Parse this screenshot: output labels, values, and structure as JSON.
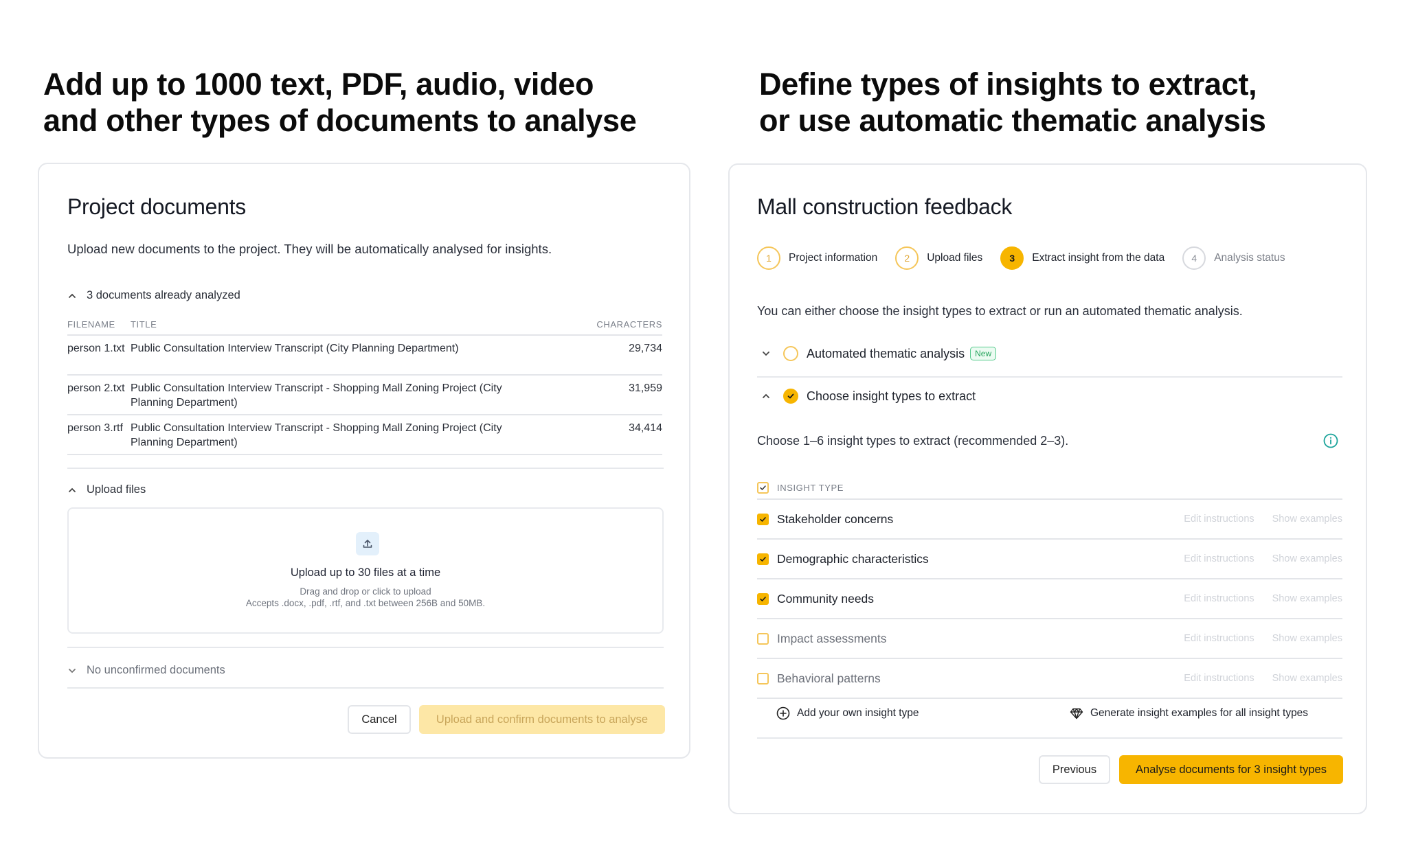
{
  "headline_left": {
    "line1": "Add up to 1000 text, PDF, audio, video",
    "line2": "and other types of documents to analyse"
  },
  "headline_right": {
    "line1": "Define types of insights to extract,",
    "line2": "or use automatic thematic analysis"
  },
  "project_docs": {
    "title": "Project documents",
    "description": "Upload new documents to the project. They will be automatically analysed for insights.",
    "analyzed_toggle": "3 documents already analyzed",
    "table": {
      "headers": {
        "filename": "FILENAME",
        "title": "TITLE",
        "characters": "CHARACTERS"
      },
      "rows": [
        {
          "filename": "person 1.txt",
          "title": "Public Consultation Interview Transcript (City Planning Department)",
          "characters": "29,734"
        },
        {
          "filename": "person 2.txt",
          "title": "Public Consultation Interview Transcript - Shopping Mall Zoning Project (City Planning Department)",
          "characters": "31,959"
        },
        {
          "filename": "person 3.rtf",
          "title": "Public Consultation Interview Transcript - Shopping Mall Zoning Project (City Planning Department)",
          "characters": "34,414"
        }
      ]
    },
    "upload_toggle": "Upload files",
    "upload": {
      "title": "Upload up to 30 files at a time",
      "sub1": "Drag and drop or click to upload",
      "sub2": "Accepts .docx, .pdf, .rtf, and .txt between 256B and 50MB."
    },
    "unconfirmed_toggle": "No unconfirmed documents",
    "cancel_label": "Cancel",
    "upload_confirm_label": "Upload and confirm documents to analyse"
  },
  "mall": {
    "title": "Mall construction feedback",
    "steps": [
      {
        "num": "1",
        "label": "Project information",
        "state": "done"
      },
      {
        "num": "2",
        "label": "Upload files",
        "state": "done"
      },
      {
        "num": "3",
        "label": "Extract insight from the data",
        "state": "active"
      },
      {
        "num": "4",
        "label": "Analysis status",
        "state": "pending"
      }
    ],
    "description": "You can either choose the insight types to extract or run an automated thematic analysis.",
    "option_auto": "Automated thematic analysis",
    "badge_new": "New",
    "option_choose": "Choose insight types to extract",
    "choose_desc": "Choose 1–6 insight types to extract (recommended 2–3).",
    "insight_header": "INSIGHT TYPE",
    "edit_label": "Edit instructions",
    "examples_label": "Show examples",
    "insights": [
      {
        "name": "Stakeholder concerns",
        "checked": true
      },
      {
        "name": "Demographic characteristics",
        "checked": true
      },
      {
        "name": "Community needs",
        "checked": true
      },
      {
        "name": "Impact assessments",
        "checked": false
      },
      {
        "name": "Behavioral patterns",
        "checked": false
      }
    ],
    "add_own": "Add your own insight type",
    "generate_examples": "Generate insight examples for all insight types",
    "previous_label": "Previous",
    "analyse_label": "Analyse documents for 3 insight types"
  },
  "colors": {
    "accent": "#f7b500",
    "accent_light": "#fde7a6",
    "new_badge": "#22a35a",
    "info": "#1aa39a"
  },
  "icons": [
    "chevron-up-icon",
    "chevron-down-icon",
    "upload-icon",
    "check-icon",
    "info-icon",
    "plus-circle-icon",
    "gem-icon"
  ]
}
